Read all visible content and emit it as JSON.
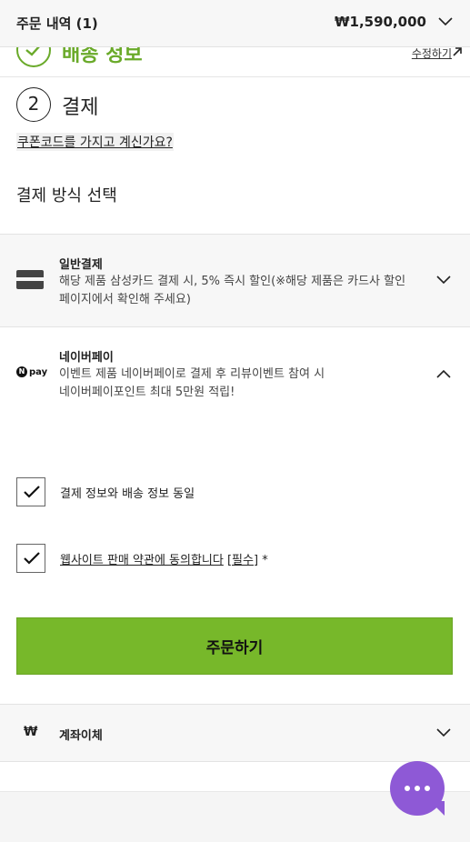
{
  "order_summary": {
    "title": "주문 내역 (1)",
    "total": "₩1,590,000",
    "chevron_icon": "chevron-down-icon"
  },
  "shipping": {
    "title": "배송 정보",
    "edit_label": "수정하기",
    "status_icon": "checkmark-icon",
    "accent_color": "#6aaa2a"
  },
  "payment": {
    "step_number": "2",
    "title": "결제",
    "coupon_link": "쿠폰코드를 가지고 계신가요?",
    "method_heading": "결제 방식 선택",
    "options": [
      {
        "name": "일반결제",
        "desc_line1": "해당 제품 삼성카드 결제 시, 5% 즉시 할인(※해당 제품은 카드사 할인",
        "desc_line2": "페이지에서 확인해 주세요)",
        "icon": "credit-card-icon",
        "expanded": false
      },
      {
        "name": "네이버페이",
        "desc_line1": "이벤트 제품 네이버페이로 결제 후 리뷰이벤트 참여 시",
        "desc_line2": "네이버페이포인트 최대 5만원 적립!",
        "icon": "npay-icon",
        "icon_text": "pay",
        "icon_badge": "N",
        "expanded": true
      },
      {
        "name": "계좌이체",
        "icon": "won-icon",
        "icon_text": "₩",
        "expanded": false
      }
    ]
  },
  "agreements": {
    "same_address": {
      "label": "결제 정보와 배송 정보 동일",
      "checked": true
    },
    "terms": {
      "label_link": "웹사이트 판매 약관에 동의합니다",
      "label_required": "[필수]",
      "label_star": "*",
      "checked": true
    }
  },
  "order_button": {
    "label": "주문하기",
    "color": "#77b82a"
  },
  "chat": {
    "icon": "chat-bubble-icon",
    "color": "#8e59d6"
  }
}
